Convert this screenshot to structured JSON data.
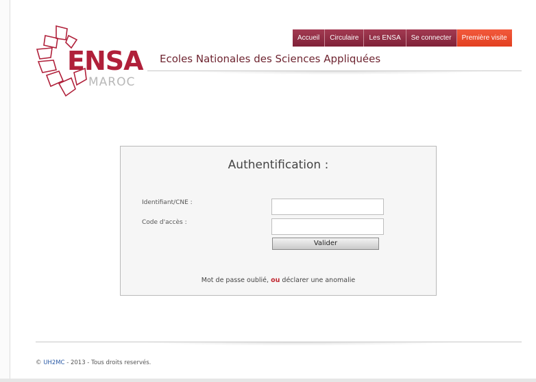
{
  "brand": {
    "logo_text": "ENSA",
    "logo_subtext": "MAROC",
    "site_title": "Ecoles Nationales des Sciences Appliquées",
    "accent_color": "#b0203a"
  },
  "nav": {
    "items": [
      {
        "label": "Accueil"
      },
      {
        "label": "Circulaire"
      },
      {
        "label": "Les ENSA"
      },
      {
        "label": "Se connecter"
      },
      {
        "label": "Première visite"
      }
    ]
  },
  "auth": {
    "title": "Authentification :",
    "id_label": "Identifiant/CNE :",
    "code_label": "Code d'accès :",
    "id_value": "",
    "code_value": "",
    "submit_label": "Valider",
    "forgot_text": "Mot de passe oublié,",
    "or_text": "ou",
    "anomaly_text": "déclarer une anomalie"
  },
  "footer": {
    "copyright_symbol": "©",
    "org_link": "UH2MC",
    "rest": " - 2013 - Tous droits reservés."
  }
}
